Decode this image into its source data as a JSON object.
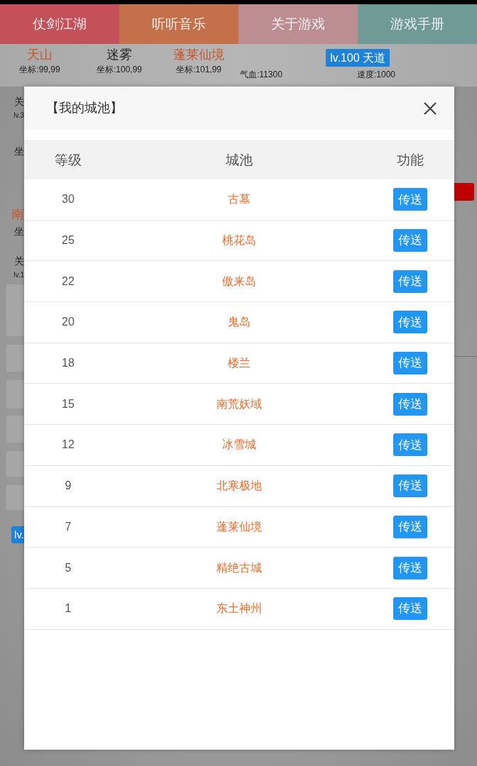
{
  "tabs": [
    {
      "label": "仗剑江湖",
      "color": "#c4505a"
    },
    {
      "label": "听听音乐",
      "color": "#c4704a"
    },
    {
      "label": "关于游戏",
      "color": "#bc8e92"
    },
    {
      "label": "游戏手册",
      "color": "#6f9a96"
    }
  ],
  "map": {
    "cells": [
      {
        "name": "天山",
        "coords": "坐标:99,99",
        "color": "#c8562c"
      },
      {
        "name": "迷雾",
        "coords": "坐标:100,99",
        "color": "#222222"
      },
      {
        "name": "蓬莱仙境",
        "coords": "坐标:101,99",
        "color": "#c8562c"
      }
    ]
  },
  "player": {
    "badge": "lv.100 天道",
    "hp": "气血:11300",
    "speed": "速度:1000"
  },
  "side_fragments": [
    {
      "text": "关",
      "kind": "label"
    },
    {
      "text": "lv.3",
      "kind": "small"
    },
    {
      "text": "坐",
      "kind": "label"
    },
    {
      "text": "南",
      "kind": "city"
    },
    {
      "text": "坐",
      "kind": "label"
    },
    {
      "text": "关",
      "kind": "label"
    },
    {
      "text": "lv.1",
      "kind": "small"
    },
    {
      "text": "lv.",
      "kind": "badge"
    }
  ],
  "dialog": {
    "title": "【我的城池】",
    "columns": [
      "等级",
      "城池",
      "功能"
    ],
    "rows": [
      {
        "level": "30",
        "city": "古墓",
        "action": "传送"
      },
      {
        "level": "25",
        "city": "桃花岛",
        "action": "传送"
      },
      {
        "level": "22",
        "city": "傲来岛",
        "action": "传送"
      },
      {
        "level": "20",
        "city": "鬼岛",
        "action": "传送"
      },
      {
        "level": "18",
        "city": "楼兰",
        "action": "传送"
      },
      {
        "level": "15",
        "city": "南荒妖域",
        "action": "传送"
      },
      {
        "level": "12",
        "city": "冰雪城",
        "action": "传送"
      },
      {
        "level": "9",
        "city": "北寒极地",
        "action": "传送"
      },
      {
        "level": "7",
        "city": "蓬莱仙境",
        "action": "传送"
      },
      {
        "level": "5",
        "city": "精绝古城",
        "action": "传送"
      },
      {
        "level": "1",
        "city": "东土神州",
        "action": "传送"
      }
    ]
  }
}
